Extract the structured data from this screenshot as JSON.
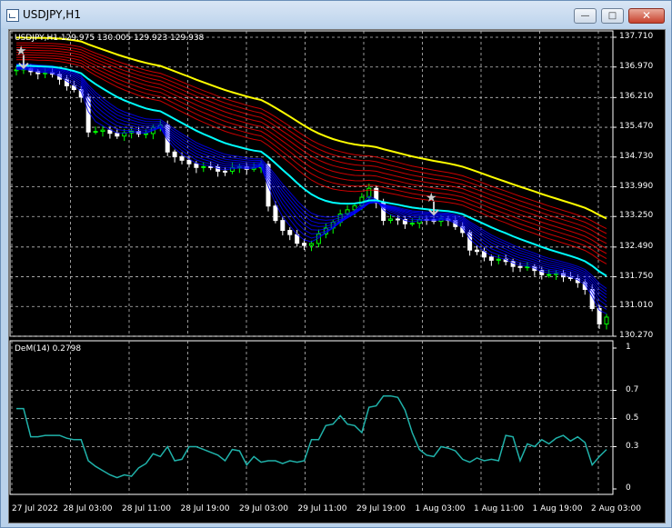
{
  "window": {
    "title": "USDJPY,H1",
    "minimize_glyph": "—",
    "maximize_glyph": "□",
    "close_glyph": "✕"
  },
  "main_panel": {
    "header": "USDJPY,H1  129.975 130.005 129.923 129.938",
    "price_axis": [
      "137.710",
      "136.970",
      "136.210",
      "135.470",
      "134.730",
      "133.990",
      "133.250",
      "132.490",
      "131.750",
      "131.010",
      "130.270"
    ]
  },
  "indicator_panel": {
    "header": "DeM(14) 0.2798",
    "axis": [
      "1",
      "0.7",
      "0.5",
      "0.3",
      "0"
    ]
  },
  "time_axis": [
    "27 Jul 2022",
    "28 Jul 03:00",
    "28 Jul 11:00",
    "28 Jul 19:00",
    "29 Jul 03:00",
    "29 Jul 11:00",
    "29 Jul 19:00",
    "1 Aug 03:00",
    "1 Aug 11:00",
    "1 Aug 19:00",
    "2 Aug 03:00"
  ],
  "colors": {
    "background": "#000000",
    "grid": "#c0c0c0",
    "bull": "#00ff00",
    "bear": "#ffffff",
    "ema_fast": "#0000ff",
    "ema_mid": "#00ffff",
    "ema_slow": "#ff0000",
    "ema_slowest": "#ffff00",
    "dem_line": "#20b2aa"
  },
  "arrows": [
    "sell-arrow",
    "sell-arrow"
  ]
}
